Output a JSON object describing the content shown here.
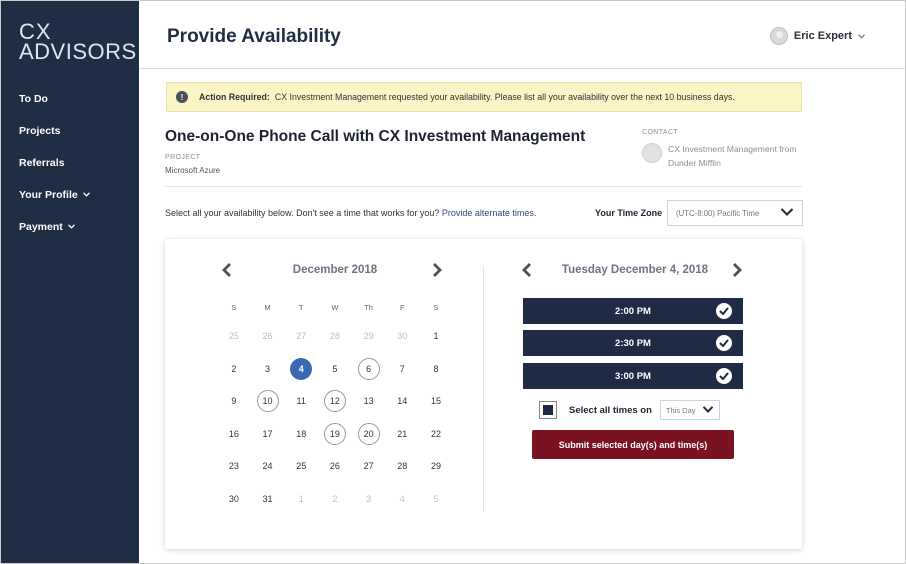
{
  "sidebar": {
    "logo_line1": "CX",
    "logo_line2": "ADVISORS",
    "items": [
      {
        "label": "To Do",
        "has_chevron": false
      },
      {
        "label": "Projects",
        "has_chevron": false
      },
      {
        "label": "Referrals",
        "has_chevron": false
      },
      {
        "label": "Your Profile",
        "has_chevron": true
      },
      {
        "label": "Payment",
        "has_chevron": true
      }
    ]
  },
  "header": {
    "title": "Provide Availability",
    "user_name": "Eric Expert"
  },
  "alert": {
    "label": "Action Required:",
    "message": "CX Investment Management requested your availability. Please list all your availability over the next 10 business days."
  },
  "meeting": {
    "title": "One-on-One Phone Call with CX Investment Management",
    "project_label": "PROJECT",
    "project_value": "Microsoft Azure",
    "contact_label": "CONTACT",
    "contact_name": "CX Investment Management from Dunder Mifflin"
  },
  "instructions": {
    "text": "Select all your availability below.  Don't see a time that works for you?",
    "link": "Provide alternate times."
  },
  "timezone": {
    "label": "Your Time Zone",
    "value": "(UTC-8:00) Pacific Time"
  },
  "calendar": {
    "month": "December 2018",
    "weekdays": [
      "S",
      "M",
      "T",
      "W",
      "Th",
      "F",
      "S"
    ],
    "weeks": [
      [
        {
          "d": "25",
          "s": "muted"
        },
        {
          "d": "26",
          "s": "muted"
        },
        {
          "d": "27",
          "s": "muted"
        },
        {
          "d": "28",
          "s": "muted"
        },
        {
          "d": "29",
          "s": "muted"
        },
        {
          "d": "30",
          "s": "muted"
        },
        {
          "d": "1",
          "s": ""
        }
      ],
      [
        {
          "d": "2",
          "s": ""
        },
        {
          "d": "3",
          "s": ""
        },
        {
          "d": "4",
          "s": "selected"
        },
        {
          "d": "5",
          "s": ""
        },
        {
          "d": "6",
          "s": "ring"
        },
        {
          "d": "7",
          "s": ""
        },
        {
          "d": "8",
          "s": ""
        }
      ],
      [
        {
          "d": "9",
          "s": ""
        },
        {
          "d": "10",
          "s": "ring"
        },
        {
          "d": "11",
          "s": ""
        },
        {
          "d": "12",
          "s": "ring"
        },
        {
          "d": "13",
          "s": ""
        },
        {
          "d": "14",
          "s": ""
        },
        {
          "d": "15",
          "s": ""
        }
      ],
      [
        {
          "d": "16",
          "s": ""
        },
        {
          "d": "17",
          "s": ""
        },
        {
          "d": "18",
          "s": ""
        },
        {
          "d": "19",
          "s": "ring"
        },
        {
          "d": "20",
          "s": "ring"
        },
        {
          "d": "21",
          "s": ""
        },
        {
          "d": "22",
          "s": ""
        }
      ],
      [
        {
          "d": "23",
          "s": ""
        },
        {
          "d": "24",
          "s": ""
        },
        {
          "d": "25",
          "s": ""
        },
        {
          "d": "26",
          "s": ""
        },
        {
          "d": "27",
          "s": ""
        },
        {
          "d": "28",
          "s": ""
        },
        {
          "d": "29",
          "s": ""
        }
      ],
      [
        {
          "d": "30",
          "s": ""
        },
        {
          "d": "31",
          "s": ""
        },
        {
          "d": "1",
          "s": "muted"
        },
        {
          "d": "2",
          "s": "muted"
        },
        {
          "d": "3",
          "s": "muted"
        },
        {
          "d": "4",
          "s": "muted"
        },
        {
          "d": "5",
          "s": "muted"
        }
      ]
    ]
  },
  "day_panel": {
    "date": "Tuesday December 4, 2018",
    "slots": [
      {
        "time": "2:00 PM",
        "checked": true
      },
      {
        "time": "2:30 PM",
        "checked": true
      },
      {
        "time": "3:00 PM",
        "checked": true
      }
    ],
    "select_all_label": "Select all times on",
    "scope_value": "This Day",
    "submit_label": "Submit selected day(s) and time(s)"
  },
  "colors": {
    "sidebar": "#1f2d45",
    "slot": "#1f2a44",
    "selected_day": "#3a68b3",
    "submit": "#7a1222",
    "alert_bg": "#fbf4c6"
  }
}
